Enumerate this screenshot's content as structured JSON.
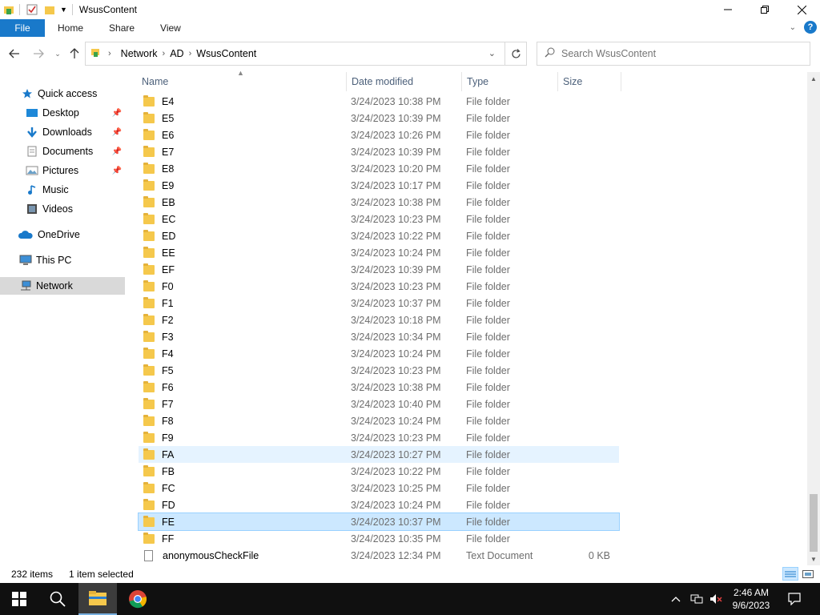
{
  "window": {
    "title": "WsusContent"
  },
  "ribbon": {
    "tabs": [
      "File",
      "Home",
      "Share",
      "View"
    ]
  },
  "address": {
    "crumbs": [
      "Network",
      "AD",
      "WsusContent"
    ],
    "search_placeholder": "Search WsusContent"
  },
  "nav": {
    "quick_access": "Quick access",
    "desktop": "Desktop",
    "downloads": "Downloads",
    "documents": "Documents",
    "pictures": "Pictures",
    "music": "Music",
    "videos": "Videos",
    "onedrive": "OneDrive",
    "this_pc": "This PC",
    "network": "Network"
  },
  "columns": {
    "name": "Name",
    "date": "Date modified",
    "type": "Type",
    "size": "Size"
  },
  "files": [
    {
      "name": "E4",
      "date": "3/24/2023 10:38 PM",
      "type": "File folder",
      "size": "",
      "kind": "folder"
    },
    {
      "name": "E5",
      "date": "3/24/2023 10:39 PM",
      "type": "File folder",
      "size": "",
      "kind": "folder"
    },
    {
      "name": "E6",
      "date": "3/24/2023 10:26 PM",
      "type": "File folder",
      "size": "",
      "kind": "folder"
    },
    {
      "name": "E7",
      "date": "3/24/2023 10:39 PM",
      "type": "File folder",
      "size": "",
      "kind": "folder"
    },
    {
      "name": "E8",
      "date": "3/24/2023 10:20 PM",
      "type": "File folder",
      "size": "",
      "kind": "folder"
    },
    {
      "name": "E9",
      "date": "3/24/2023 10:17 PM",
      "type": "File folder",
      "size": "",
      "kind": "folder"
    },
    {
      "name": "EB",
      "date": "3/24/2023 10:38 PM",
      "type": "File folder",
      "size": "",
      "kind": "folder"
    },
    {
      "name": "EC",
      "date": "3/24/2023 10:23 PM",
      "type": "File folder",
      "size": "",
      "kind": "folder"
    },
    {
      "name": "ED",
      "date": "3/24/2023 10:22 PM",
      "type": "File folder",
      "size": "",
      "kind": "folder"
    },
    {
      "name": "EE",
      "date": "3/24/2023 10:24 PM",
      "type": "File folder",
      "size": "",
      "kind": "folder"
    },
    {
      "name": "EF",
      "date": "3/24/2023 10:39 PM",
      "type": "File folder",
      "size": "",
      "kind": "folder"
    },
    {
      "name": "F0",
      "date": "3/24/2023 10:23 PM",
      "type": "File folder",
      "size": "",
      "kind": "folder"
    },
    {
      "name": "F1",
      "date": "3/24/2023 10:37 PM",
      "type": "File folder",
      "size": "",
      "kind": "folder"
    },
    {
      "name": "F2",
      "date": "3/24/2023 10:18 PM",
      "type": "File folder",
      "size": "",
      "kind": "folder"
    },
    {
      "name": "F3",
      "date": "3/24/2023 10:34 PM",
      "type": "File folder",
      "size": "",
      "kind": "folder"
    },
    {
      "name": "F4",
      "date": "3/24/2023 10:24 PM",
      "type": "File folder",
      "size": "",
      "kind": "folder"
    },
    {
      "name": "F5",
      "date": "3/24/2023 10:23 PM",
      "type": "File folder",
      "size": "",
      "kind": "folder"
    },
    {
      "name": "F6",
      "date": "3/24/2023 10:38 PM",
      "type": "File folder",
      "size": "",
      "kind": "folder"
    },
    {
      "name": "F7",
      "date": "3/24/2023 10:40 PM",
      "type": "File folder",
      "size": "",
      "kind": "folder"
    },
    {
      "name": "F8",
      "date": "3/24/2023 10:24 PM",
      "type": "File folder",
      "size": "",
      "kind": "folder"
    },
    {
      "name": "F9",
      "date": "3/24/2023 10:23 PM",
      "type": "File folder",
      "size": "",
      "kind": "folder"
    },
    {
      "name": "FA",
      "date": "3/24/2023 10:27 PM",
      "type": "File folder",
      "size": "",
      "kind": "folder",
      "state": "hover"
    },
    {
      "name": "FB",
      "date": "3/24/2023 10:22 PM",
      "type": "File folder",
      "size": "",
      "kind": "folder"
    },
    {
      "name": "FC",
      "date": "3/24/2023 10:25 PM",
      "type": "File folder",
      "size": "",
      "kind": "folder"
    },
    {
      "name": "FD",
      "date": "3/24/2023 10:24 PM",
      "type": "File folder",
      "size": "",
      "kind": "folder"
    },
    {
      "name": "FE",
      "date": "3/24/2023 10:37 PM",
      "type": "File folder",
      "size": "",
      "kind": "folder",
      "state": "selected"
    },
    {
      "name": "FF",
      "date": "3/24/2023 10:35 PM",
      "type": "File folder",
      "size": "",
      "kind": "folder"
    },
    {
      "name": "anonymousCheckFile",
      "date": "3/24/2023 12:34 PM",
      "type": "Text Document",
      "size": "0 KB",
      "kind": "doc"
    }
  ],
  "status": {
    "count": "232 items",
    "selection": "1 item selected"
  },
  "clock": {
    "time": "2:46 AM",
    "date": "9/6/2023"
  },
  "colors": {
    "accent": "#1979ca",
    "selected_row": "#cce8ff",
    "hover_row": "#e5f3ff",
    "taskbar": "#101010"
  }
}
